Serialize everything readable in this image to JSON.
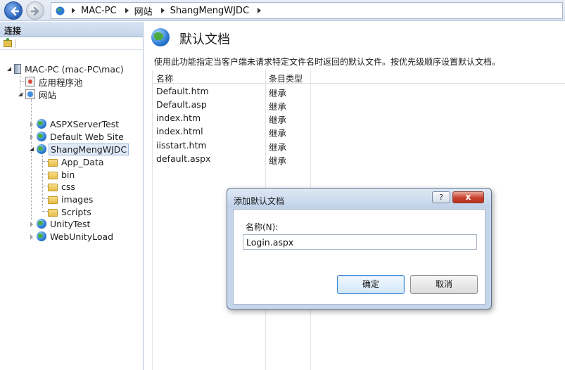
{
  "breadcrumb": {
    "items": [
      "MAC-PC",
      "网站",
      "ShangMengWJDC"
    ]
  },
  "connections": {
    "title": "连接",
    "tree": {
      "server": "MAC-PC (mac-PC\\mac)",
      "app_pools": "应用程序池",
      "sites": "网站",
      "site_items": [
        "ASPXServerTest",
        "Default Web Site",
        "ShangMengWJDC",
        "UnityTest",
        "WebUnityLoad"
      ],
      "folders": [
        "App_Data",
        "bin",
        "css",
        "images",
        "Scripts"
      ]
    }
  },
  "main": {
    "title": "默认文档",
    "description": "使用此功能指定当客户端未请求特定文件名时返回的默认文件。按优先级顺序设置默认文档。",
    "columns": [
      "名称",
      "条目类型"
    ],
    "rows": [
      {
        "name": "Default.htm",
        "type": "继承"
      },
      {
        "name": "Default.asp",
        "type": "继承"
      },
      {
        "name": "index.htm",
        "type": "继承"
      },
      {
        "name": "index.html",
        "type": "继承"
      },
      {
        "name": "iisstart.htm",
        "type": "继承"
      },
      {
        "name": "default.aspx",
        "type": "继承"
      }
    ]
  },
  "dialog": {
    "title": "添加默认文档",
    "help_label": "?",
    "close_label": "x",
    "field_label": "名称(N):",
    "field_value": "Login.aspx",
    "ok_label": "确定",
    "cancel_label": "取消"
  },
  "colors": {
    "accent": "#3f8bd6",
    "close": "#c7412e",
    "header_bg": "#c3d3ea"
  }
}
